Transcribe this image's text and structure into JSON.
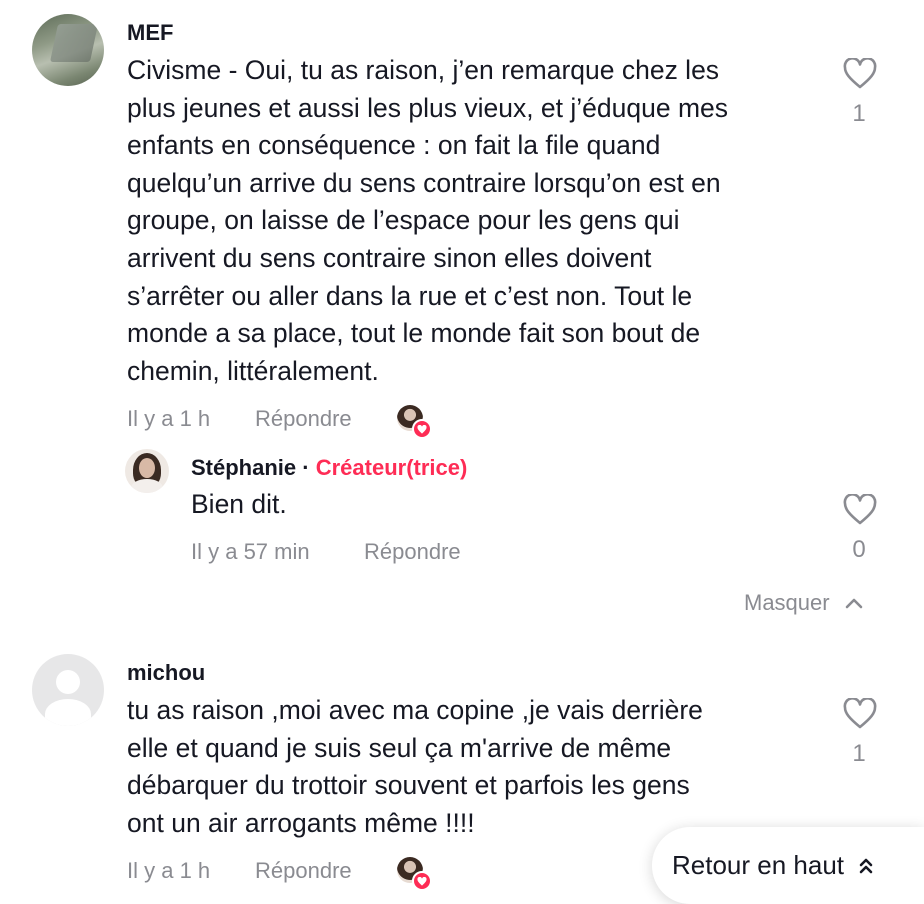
{
  "comments": [
    {
      "username": "MEF",
      "lines": [
        "Civisme - Oui, tu as raison, j’en remarque chez les",
        "plus jeunes et aussi les plus vieux, et j’éduque mes",
        "enfants en conséquence : on fait la file quand",
        "quelqu’un arrive du sens contraire lorsqu’on est en",
        "groupe, on laisse de l’espace pour les gens qui",
        "arrivent du sens contraire sinon elles doivent",
        "s’arrêter ou aller dans la rue et c’est non. Tout le",
        "monde a sa place, tout le monde fait son bout de",
        "chemin, littéralement."
      ],
      "time": "Il y a 1 h",
      "reply_label": "Répondre",
      "likes": "1",
      "reply": {
        "username": "Stéphanie",
        "separator": "·",
        "creator_label": "Créateur(trice)",
        "text": "Bien dit.",
        "time": "Il y a 57 min",
        "reply_label": "Répondre",
        "likes": "0"
      },
      "hide_label": "Masquer"
    },
    {
      "username": "michou",
      "lines": [
        "tu as raison ,moi avec ma copine ,je vais derrière",
        "elle et quand je suis seul ça m'arrive de même",
        "débarquer du trottoir souvent et parfois les gens",
        "ont un air arrogants même !!!!"
      ],
      "time": "Il y a 1 h",
      "reply_label": "Répondre",
      "likes": "1"
    }
  ],
  "back_to_top_label": "Retour en haut",
  "colors": {
    "accent": "#fe2c55",
    "secondary_text": "#8a8b91",
    "primary_text": "#161823"
  }
}
